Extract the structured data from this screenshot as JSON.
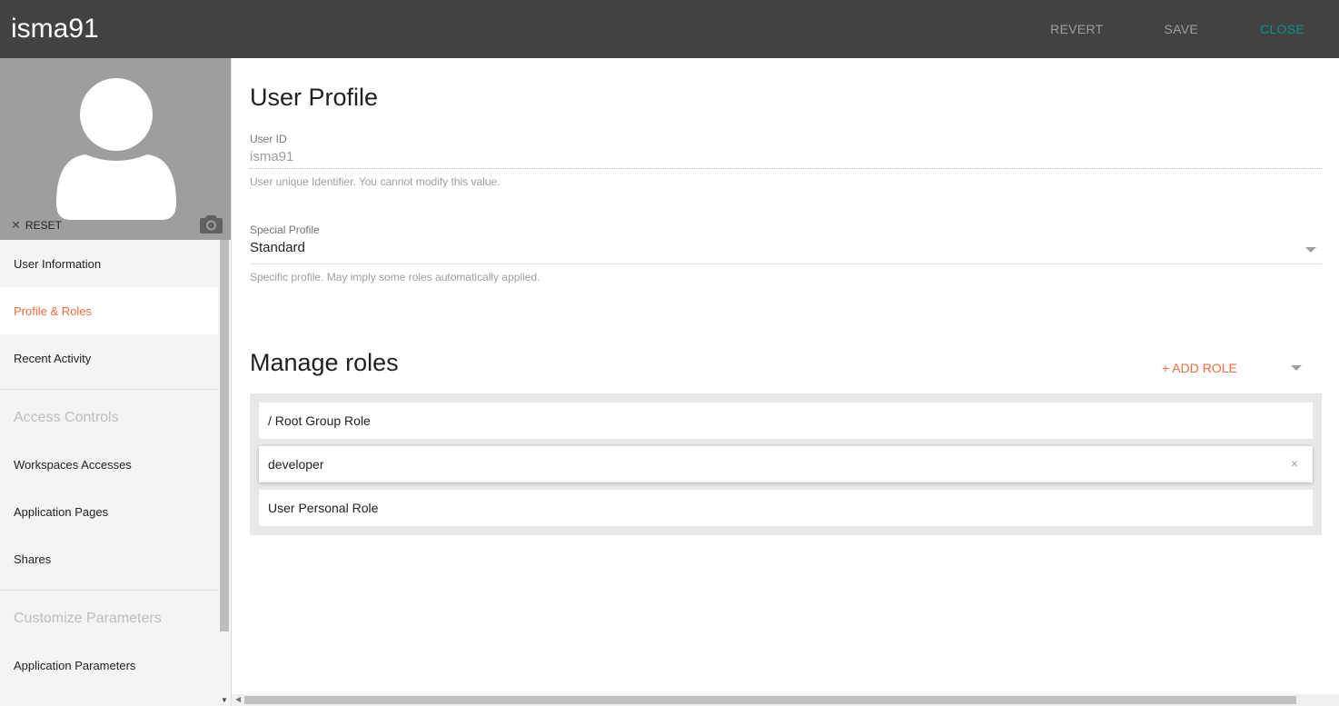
{
  "header": {
    "title": "isma91",
    "actions": {
      "revert": "REVERT",
      "save": "SAVE",
      "close": "CLOSE"
    }
  },
  "sidebar": {
    "reset_label": "RESET",
    "items": [
      {
        "label": "User Information"
      },
      {
        "label": "Profile & Roles"
      },
      {
        "label": "Recent Activity"
      }
    ],
    "sections": [
      {
        "header": "Access Controls",
        "items": [
          {
            "label": "Workspaces Accesses"
          },
          {
            "label": "Application Pages"
          },
          {
            "label": "Shares"
          }
        ]
      },
      {
        "header": "Customize Parameters",
        "items": [
          {
            "label": "Application Parameters"
          }
        ]
      }
    ]
  },
  "main": {
    "title": "User Profile",
    "user_id": {
      "label": "User ID",
      "value": "isma91",
      "hint": "User unique Identifier. You cannot modify this value."
    },
    "special_profile": {
      "label": "Special Profile",
      "value": "Standard",
      "hint": "Specific profile. May imply some roles automatically applied."
    },
    "roles": {
      "title": "Manage roles",
      "add_label": "+ ADD ROLE",
      "items": [
        {
          "label": "/ Root Group Role"
        },
        {
          "label": "developer",
          "remove_icon": "×"
        },
        {
          "label": "User Personal Role"
        }
      ]
    }
  },
  "colors": {
    "accent": "#ef6c3a",
    "close": "#009688",
    "topbar": "#424242"
  }
}
